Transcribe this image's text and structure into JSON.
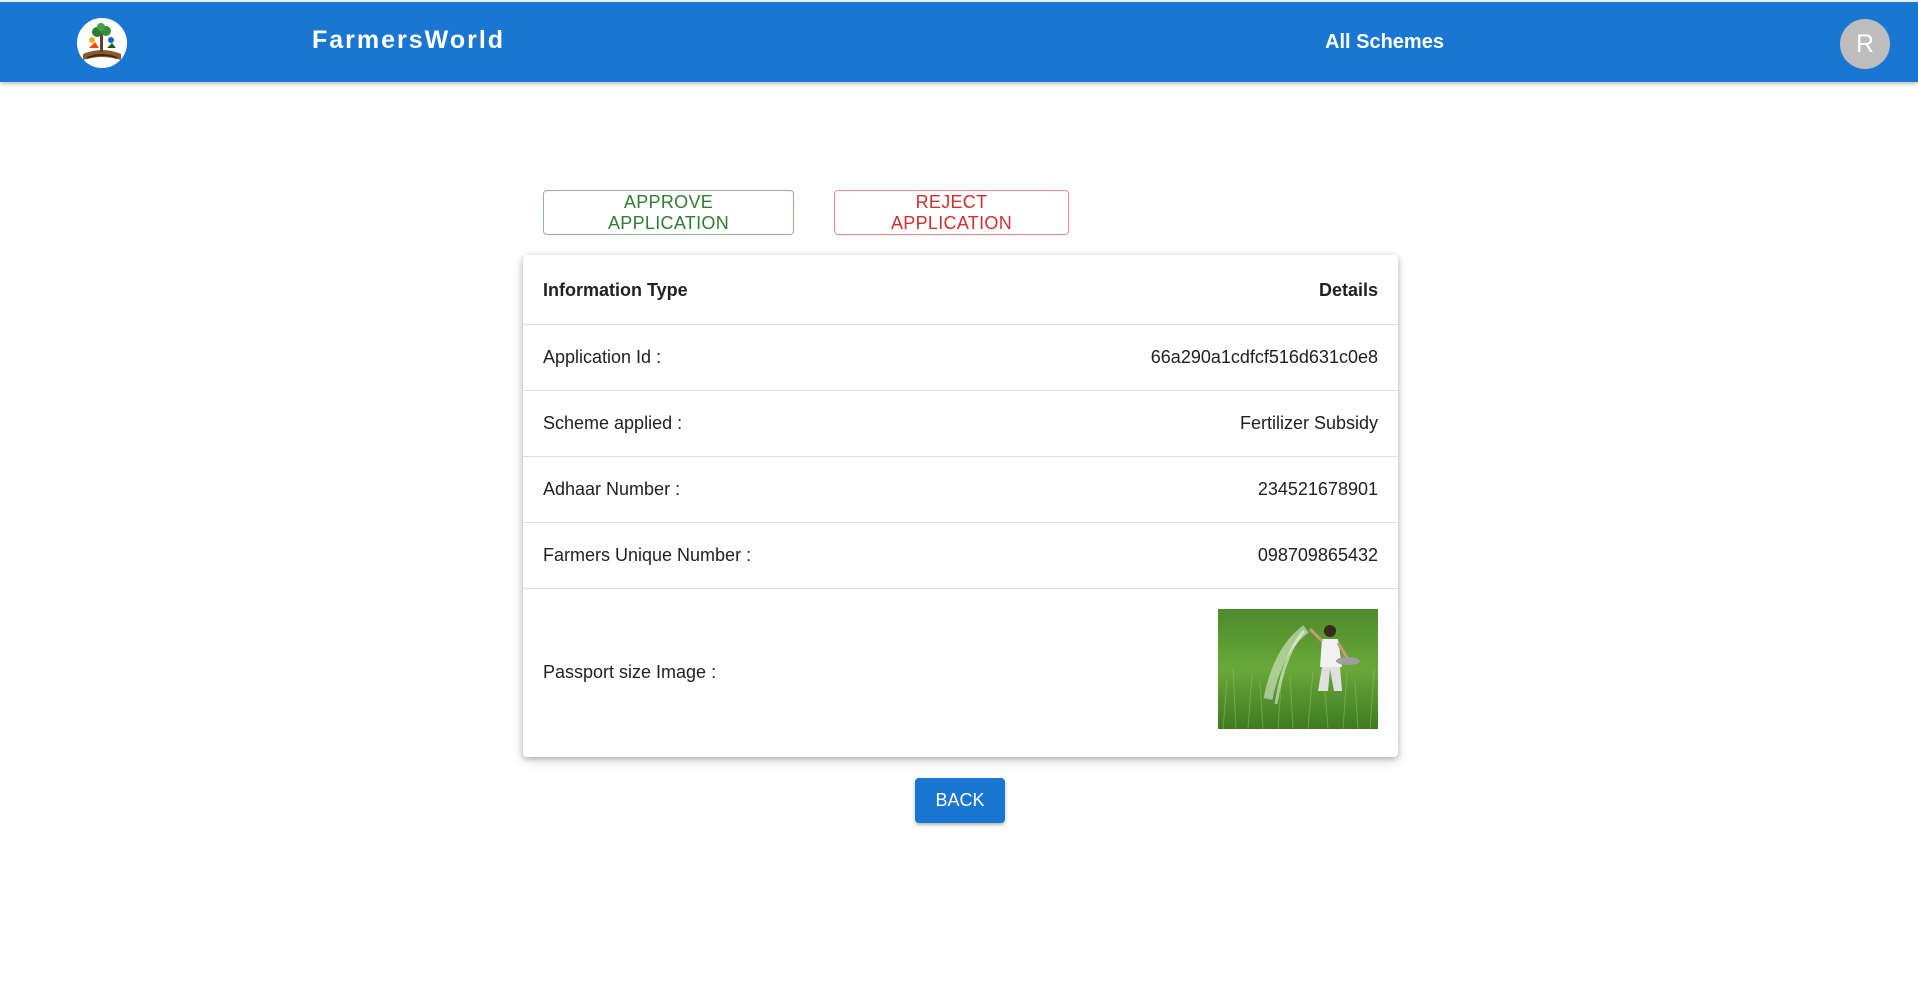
{
  "header": {
    "brand": "FarmersWorld",
    "nav_all_schemes": "All Schemes",
    "avatar_letter": "R",
    "bar_color": "#1976d2"
  },
  "actions": {
    "approve_label": "APPROVE APPLICATION",
    "reject_label": "REJECT APPLICATION",
    "approve_color": "#2e7d32",
    "reject_color": "#d32f2f"
  },
  "table": {
    "col_info": "Information Type",
    "col_details": "Details",
    "rows": [
      {
        "label": "Application Id :",
        "value": "66a290a1cdfcf516d631c0e8"
      },
      {
        "label": "Scheme applied :",
        "value": "Fertilizer Subsidy"
      },
      {
        "label": "Adhaar Number :",
        "value": "234521678901"
      },
      {
        "label": "Farmers Unique Number :",
        "value": "098709865432"
      }
    ],
    "image_row_label": "Passport size Image :"
  },
  "footer": {
    "back_label": "BACK"
  }
}
